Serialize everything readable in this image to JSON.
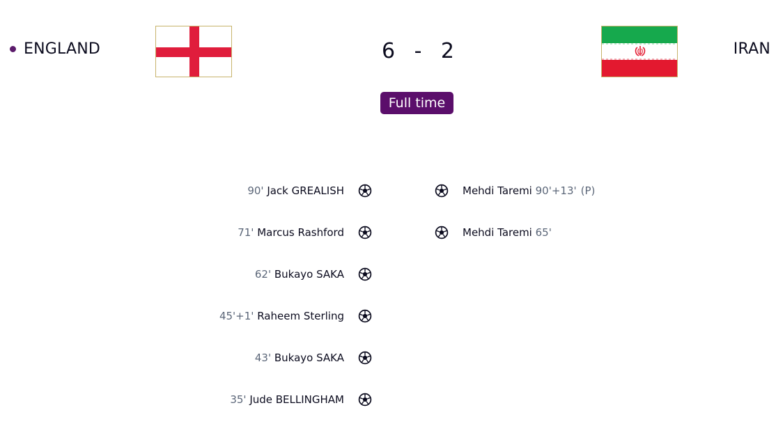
{
  "match": {
    "home_team": "ENGLAND",
    "away_team": "IRAN",
    "home_score": "6",
    "separator": "-",
    "away_score": "2",
    "status": "Full time"
  },
  "flags": {
    "home": {
      "name": "england-flag",
      "colors": {
        "cross": "#e01d3c",
        "field": "#ffffff"
      }
    },
    "away": {
      "name": "iran-flag",
      "colors": {
        "top": "#16a94d",
        "middle": "#ffffff",
        "bottom": "#e3192f"
      }
    }
  },
  "colors": {
    "accent": "#5b0e6b",
    "muted": "#5b6678",
    "text": "#0b0b1e"
  },
  "home_goals": [
    {
      "minute": "90'",
      "scorer": "Jack GREALISH",
      "icon": "soccer-ball-icon"
    },
    {
      "minute": "71'",
      "scorer": "Marcus Rashford",
      "icon": "soccer-ball-icon"
    },
    {
      "minute": "62'",
      "scorer": "Bukayo SAKA",
      "icon": "soccer-ball-icon"
    },
    {
      "minute": "45'+1'",
      "scorer": "Raheem Sterling",
      "icon": "soccer-ball-icon"
    },
    {
      "minute": "43'",
      "scorer": "Bukayo SAKA",
      "icon": "soccer-ball-icon"
    },
    {
      "minute": "35'",
      "scorer": "Jude BELLINGHAM",
      "icon": "soccer-ball-icon"
    }
  ],
  "away_goals": [
    {
      "scorer": "Mehdi Taremi",
      "minute": "90'+13'",
      "note": "(P)",
      "icon": "soccer-ball-icon"
    },
    {
      "scorer": "Mehdi Taremi",
      "minute": "65'",
      "icon": "soccer-ball-icon"
    }
  ]
}
